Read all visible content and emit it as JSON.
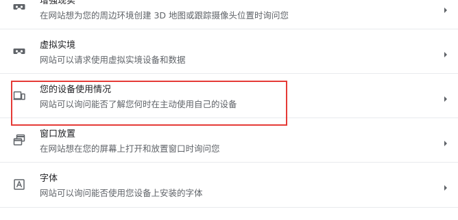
{
  "permissions": [
    {
      "icon": "vr-headset-icon",
      "title": "增强现实",
      "description": "在网站想为您的周边环境创建 3D 地图或跟踪摄像头位置时询问您"
    },
    {
      "icon": "vr-headset-icon",
      "title": "虚拟实境",
      "description": "网站可以请求使用虚拟实境设备和数据"
    },
    {
      "icon": "devices-icon",
      "title": "您的设备使用情况",
      "description": "网站可以询问能否了解您何时在主动使用自己的设备"
    },
    {
      "icon": "window-placement-icon",
      "title": "窗口放置",
      "description": "在网站想在您的屏幕上打开和放置窗口时询问您"
    },
    {
      "icon": "font-icon",
      "title": "字体",
      "description": "网站可以询问能否使用您设备上安装的字体"
    }
  ],
  "colors": {
    "highlight_border": "#e53935",
    "icon": "#5f6368",
    "divider": "#e8eaed"
  }
}
